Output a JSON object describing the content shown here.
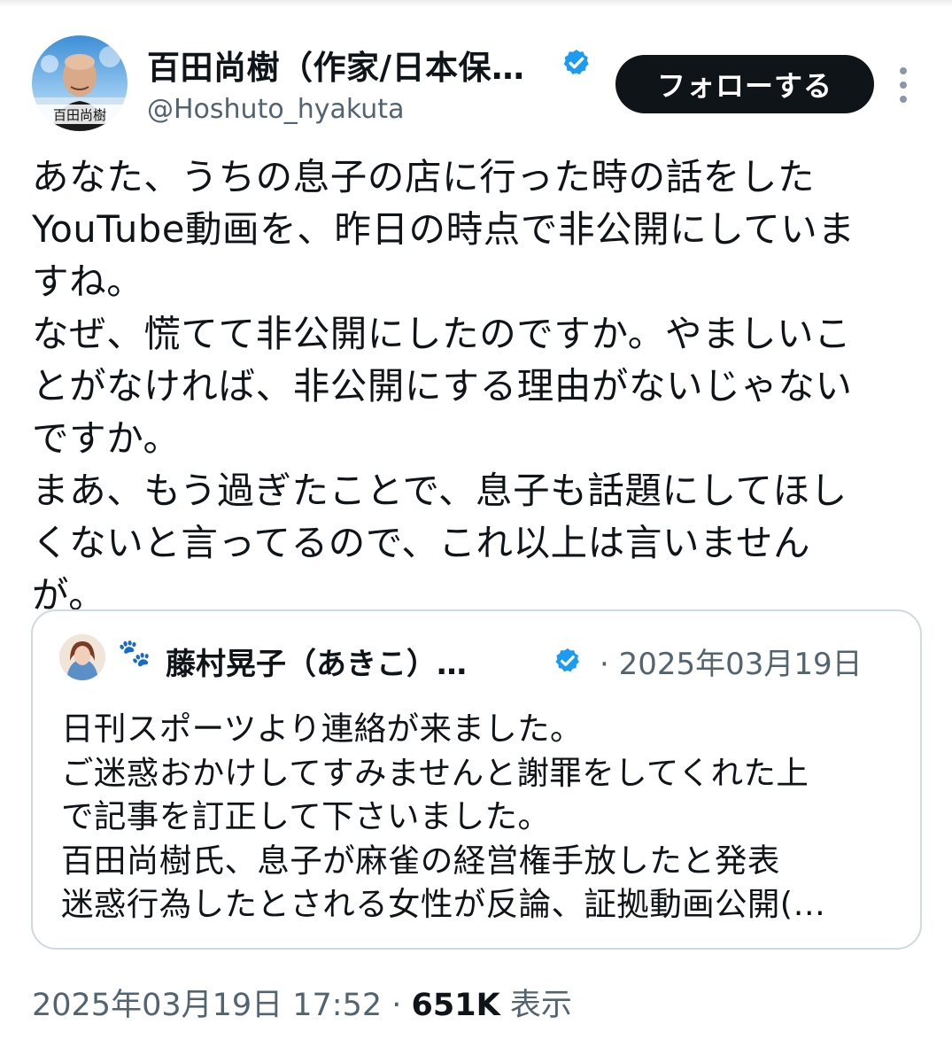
{
  "author": {
    "name": "百田尚樹（作家/日本保…",
    "handle": "@Hoshuto_hyakuta",
    "avatar_caption": "百田尚樹",
    "verified_icon": "verified-badge-icon"
  },
  "follow_button": {
    "label": "フォローする"
  },
  "more_button": {
    "icon": "more-vertical-icon"
  },
  "tweet": {
    "lines": [
      "あなた、うちの息子の店に行った時の話をした",
      "YouTube動画を、昨日の時点で非公開にしていま",
      "すね。",
      "なぜ、慌てて非公開にしたのですか。やましいこ",
      "とがなければ、非公開にする理由がないじゃない",
      "ですか。",
      "まあ、もう過ぎたことで、息子も話題にしてほし",
      "くないと言ってるので、これ以上は言いません",
      "が。"
    ]
  },
  "quoted": {
    "paw_icon": "🐾",
    "name": "藤村晃子（あきこ）…",
    "date": "· 2025年03月19日",
    "lines": [
      "日刊スポーツより連絡が来ました。",
      "ご迷惑おかけしてすみませんと謝罪をしてくれた上",
      "で記事を訂正して下さいました。",
      "百田尚樹氏、息子が麻雀の経営権手放したと発表",
      "迷惑行為したとされる女性が反論、証拠動画公開(…"
    ]
  },
  "meta": {
    "timestamp": "2025年03月19日 17:52",
    "separator": " · ",
    "views_count": "651K",
    "views_label": " 表示"
  },
  "colors": {
    "text": "#0f1419",
    "secondary": "#536471",
    "verified": "#1d9bf0",
    "border": "#cfd9de",
    "button_bg": "#0f1419"
  }
}
